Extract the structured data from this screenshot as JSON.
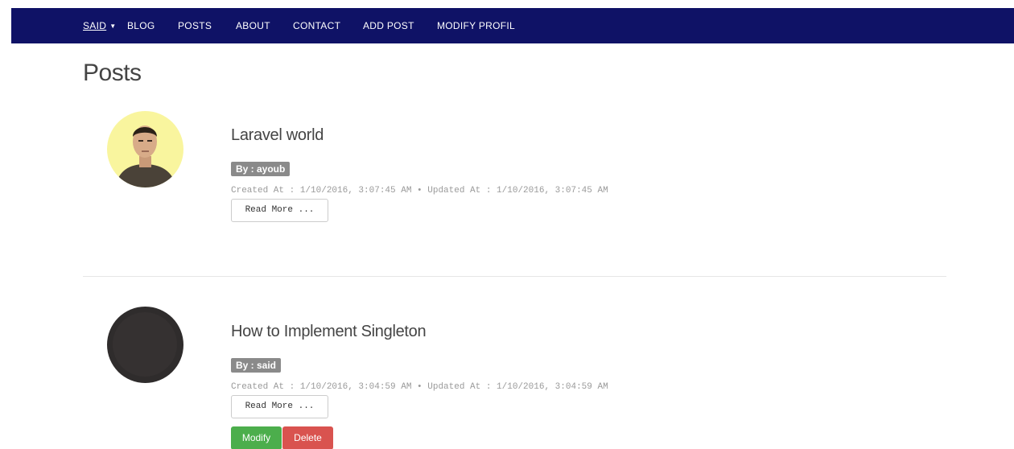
{
  "nav": {
    "user": "SAID",
    "items": [
      "BLOG",
      "POSTS",
      "ABOUT",
      "CONTACT",
      "ADD POST",
      "MODIFY PROFIL"
    ]
  },
  "page": {
    "title": "Posts"
  },
  "posts": [
    {
      "title": "Laravel world",
      "author": "By : ayoub",
      "meta": "Created At : 1/10/2016, 3:07:45 AM • Updated At : 1/10/2016, 3:07:45 AM",
      "read_more": "Read More ..."
    },
    {
      "title": "How to Implement Singleton",
      "author": "By : said",
      "meta": "Created At : 1/10/2016, 3:04:59 AM • Updated At : 1/10/2016, 3:04:59 AM",
      "read_more": "Read More ...",
      "modify_label": "Modify",
      "delete_label": "Delete"
    }
  ],
  "colors": {
    "navbar": "#0f1266",
    "modify": "#4cae4c",
    "delete": "#d9534f",
    "badge": "#8a8a8a"
  }
}
